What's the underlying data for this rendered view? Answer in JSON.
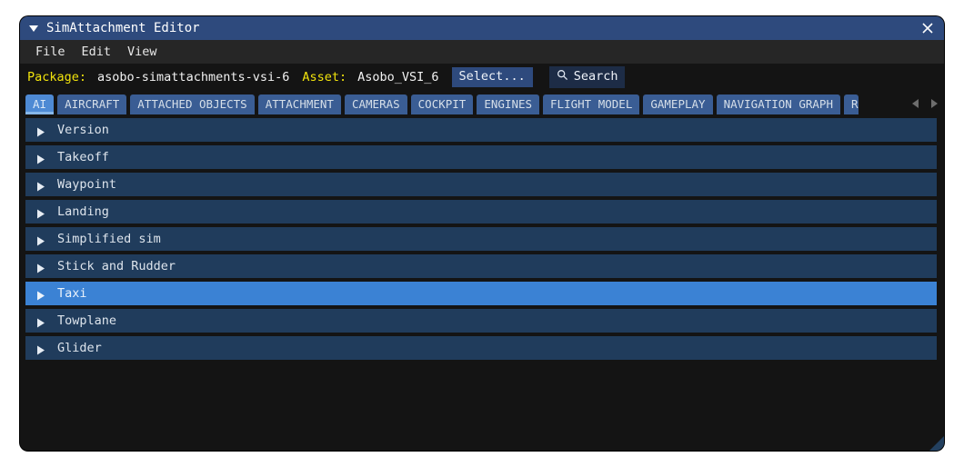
{
  "window": {
    "title": "SimAttachment Editor",
    "collapse_icon": "triangle-down-icon",
    "close_icon": "close-icon"
  },
  "menubar": {
    "items": [
      {
        "label": "File"
      },
      {
        "label": "Edit"
      },
      {
        "label": "View"
      }
    ]
  },
  "packagebar": {
    "package_label": "Package:",
    "package_value": "asobo-simattachments-vsi-6",
    "asset_label": "Asset:",
    "asset_value": "Asobo_VSI_6",
    "select_button": "Select...",
    "search_button": "Search",
    "search_icon": "magnifier-icon"
  },
  "tabs": {
    "items": [
      {
        "label": "AI",
        "active": true
      },
      {
        "label": "AIRCRAFT",
        "active": false
      },
      {
        "label": "ATTACHED OBJECTS",
        "active": false
      },
      {
        "label": "ATTACHMENT",
        "active": false
      },
      {
        "label": "CAMERAS",
        "active": false
      },
      {
        "label": "COCKPIT",
        "active": false
      },
      {
        "label": "ENGINES",
        "active": false
      },
      {
        "label": "FLIGHT MODEL",
        "active": false
      },
      {
        "label": "GAMEPLAY",
        "active": false
      },
      {
        "label": "NAVIGATION GRAPH",
        "active": false
      },
      {
        "label": "R",
        "active": false,
        "clipped": true
      }
    ],
    "nav_prev_icon": "triangle-left-icon",
    "nav_next_icon": "triangle-right-icon"
  },
  "list": {
    "rows": [
      {
        "label": "Version",
        "selected": false
      },
      {
        "label": "Takeoff",
        "selected": false
      },
      {
        "label": "Waypoint",
        "selected": false
      },
      {
        "label": "Landing",
        "selected": false
      },
      {
        "label": "Simplified sim",
        "selected": false
      },
      {
        "label": "Stick and Rudder",
        "selected": false
      },
      {
        "label": "Taxi",
        "selected": true
      },
      {
        "label": "Towplane",
        "selected": false
      },
      {
        "label": "Glider",
        "selected": false
      }
    ],
    "expand_icon": "triangle-right-icon"
  },
  "colors": {
    "titlebar": "#2e4a7d",
    "accent_yellow": "#f2e40c",
    "row": "#203c5c",
    "row_selected": "#3b82d4",
    "tab": "#3a5d94",
    "tab_active": "#4e8ad4",
    "background": "#141414"
  }
}
